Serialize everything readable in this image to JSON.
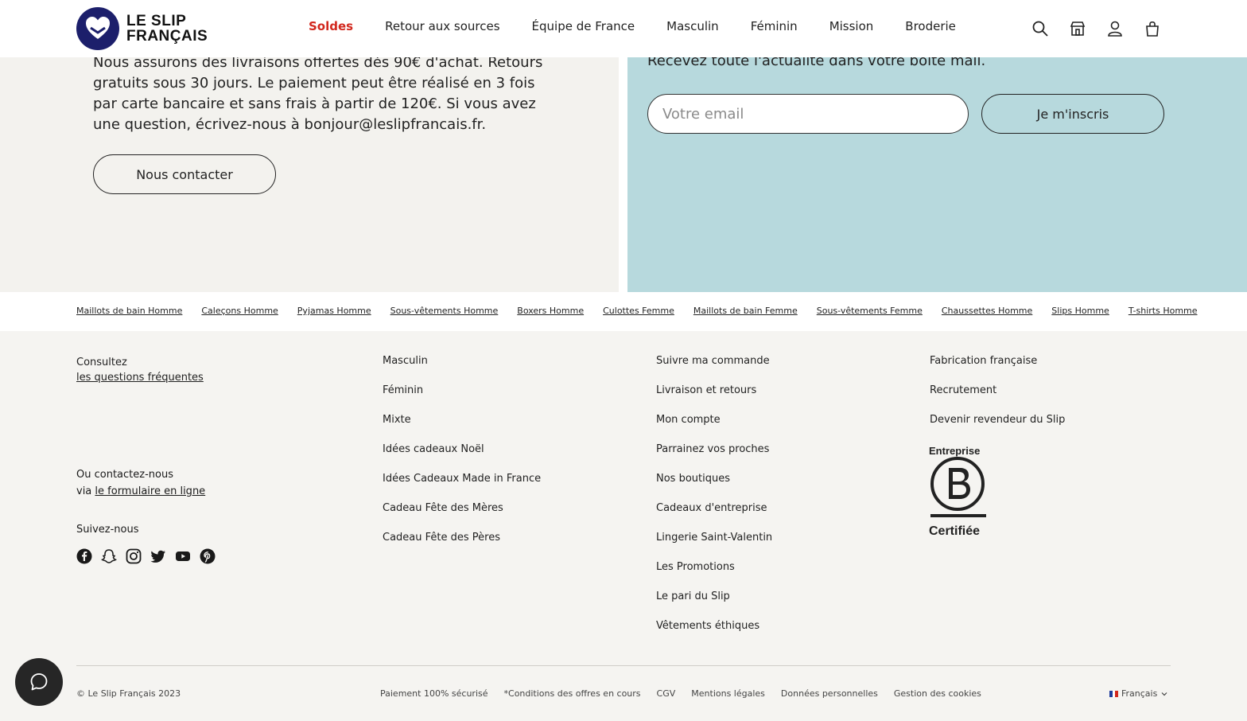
{
  "header": {
    "logo": {
      "line1": "LE SLIP",
      "line2": "FRANÇAIS"
    },
    "nav": [
      {
        "label": "Soldes",
        "accent": true
      },
      {
        "label": "Retour aux sources"
      },
      {
        "label": "Équipe de France"
      },
      {
        "label": "Masculin"
      },
      {
        "label": "Féminin"
      },
      {
        "label": "Mission"
      },
      {
        "label": "Broderie"
      }
    ],
    "icons": [
      "search-icon",
      "store-icon",
      "account-icon",
      "bag-icon"
    ]
  },
  "info": {
    "delivery_text": "Nous assurons des livraisons offertes dès 90€ d'achat. Retours gratuits sous 30 jours. Le paiement peut être réalisé en 3 fois par carte bancaire et sans frais à partir de 120€. Si vous avez une question, écrivez-nous à bonjour@leslipfrancais.fr.",
    "contact_button": "Nous contacter"
  },
  "newsletter": {
    "text": "Recevez toute l'actualité dans votre boîte mail.",
    "email_placeholder": "Votre email",
    "subscribe_button": "Je m'inscris"
  },
  "categories": [
    "Maillots de bain Homme",
    "Caleçons Homme",
    "Pyjamas Homme",
    "Sous-vêtements Homme",
    "Boxers Homme",
    "Culottes Femme",
    "Maillots de bain Femme",
    "Sous-vêtements Femme",
    "Chaussettes Homme",
    "Slips Homme",
    "T-shirts Homme"
  ],
  "footer": {
    "faq": {
      "line1": "Consultez",
      "link": "les questions fréquentes"
    },
    "contact": {
      "line1": "Ou contactez-nous",
      "prefix": "via",
      "link": "le formulaire en ligne"
    },
    "follow_label": "Suivez-nous",
    "socials": [
      "facebook-icon",
      "snapchat-icon",
      "instagram-icon",
      "twitter-icon",
      "youtube-icon",
      "pinterest-icon"
    ],
    "col2": [
      "Masculin",
      "Féminin",
      "Mixte",
      "Idées cadeaux Noël",
      "Idées Cadeaux Made in France",
      "Cadeau Fête des Mères",
      "Cadeau Fête des Pères"
    ],
    "col3": [
      "Suivre ma commande",
      "Livraison et retours",
      "Mon compte",
      "Parrainez vos proches",
      "Nos boutiques",
      "Cadeaux d'entreprise",
      "Lingerie Saint-Valentin",
      "Les Promotions",
      "Le pari du Slip",
      "Vêtements éthiques"
    ],
    "col4": [
      "Fabrication française",
      "Recrutement",
      "Devenir revendeur du Slip"
    ],
    "bcorp": {
      "top": "Entreprise",
      "bottom": "Certifiée"
    }
  },
  "bottom": {
    "copyright": "© Le Slip Français 2023",
    "legal": [
      "Paiement 100% sécurisé",
      "*Conditions des offres en cours",
      "CGV",
      "Mentions légales",
      "Données personnelles",
      "Gestion des cookies"
    ],
    "language": "Français"
  },
  "colors": {
    "accent": "#d2281e",
    "brand_navy": "#1c1f6b",
    "newsletter_bg": "#b7d9dd"
  }
}
